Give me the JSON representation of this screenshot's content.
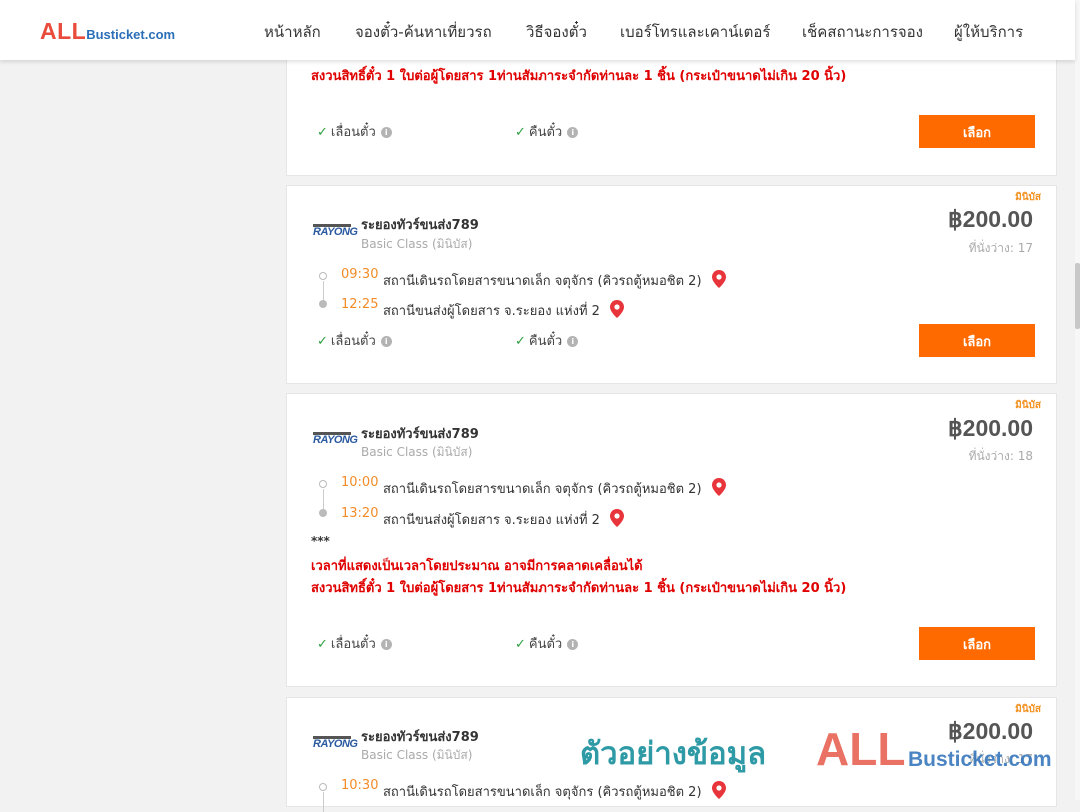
{
  "header": {
    "logo_all": "ALL",
    "logo_rest": "Busticket.com",
    "nav": [
      {
        "label": "หน้าหลัก"
      },
      {
        "label": "จองตั๋ว-ค้นหาเที่ยวรถ"
      },
      {
        "label": "วิธีจองตั๋ว"
      },
      {
        "label": "เบอร์โทรและเคาน์เตอร์"
      },
      {
        "label": "เช็คสถานะการจอง"
      },
      {
        "label": "ผู้ให้บริการ"
      }
    ]
  },
  "common": {
    "feature_reschedule": "เลื่อนตั๋ว",
    "feature_refund": "คืนตั๋ว",
    "select_label": "เลือก",
    "check_symbol": "✓",
    "info_symbol": "i",
    "stars": "***",
    "notice_time": "เวลาที่แสดงเป็นเวลาโดยประมาณ อาจมีการคลาดเคลื่อนได้",
    "notice_luggage": "สงวนสิทธิ์ตั๋ว 1 ใบต่อผู้โดยสาร 1ท่านสัมภาระจำกัดท่านละ 1 ชิ้น (กระเป๋าขนาดไม่เกิน 20 นิ้ว)",
    "logo_text": "RAYONG",
    "colors": {
      "accent": "#ff6a00",
      "notice": "#e00000",
      "time": "#f28c28",
      "check": "#2e9e3e"
    }
  },
  "trips": [
    {
      "tag": "มินิบัส",
      "operator": "ระยองทัวร์ขนส่ง789",
      "bus_class": "Basic Class (มินิบัส)",
      "price": "฿200.00",
      "seats": "ที่นั่งว่าง: 17",
      "depart_time": "09:30",
      "depart_station": "สถานีเดินรถโดยสารขนาดเล็ก จตุจักร (คิวรถตู้หมอชิต 2)",
      "arrive_time": "12:25",
      "arrive_station": "สถานีขนส่งผู้โดยสาร จ.ระยอง แห่งที่ 2"
    },
    {
      "tag": "มินิบัส",
      "operator": "ระยองทัวร์ขนส่ง789",
      "bus_class": "Basic Class (มินิบัส)",
      "price": "฿200.00",
      "seats": "ที่นั่งว่าง: 18",
      "depart_time": "10:00",
      "depart_station": "สถานีเดินรถโดยสารขนาดเล็ก จตุจักร (คิวรถตู้หมอชิต 2)",
      "arrive_time": "13:20",
      "arrive_station": "สถานีขนส่งผู้โดยสาร จ.ระยอง แห่งที่ 2"
    },
    {
      "tag": "มินิบัส",
      "operator": "ระยองทัวร์ขนส่ง789",
      "bus_class": "Basic Class (มินิบัส)",
      "price": "฿200.00",
      "seats": "ที่นั่งว่าง: 17",
      "depart_time": "10:30",
      "depart_station": "สถานีเดินรถโดยสารขนาดเล็ก จตุจักร (คิวรถตู้หมอชิต 2)"
    }
  ],
  "watermark": {
    "thai": "ตัวอย่างข้อมูล",
    "all": "ALL",
    "rest": "Busticket.com"
  }
}
